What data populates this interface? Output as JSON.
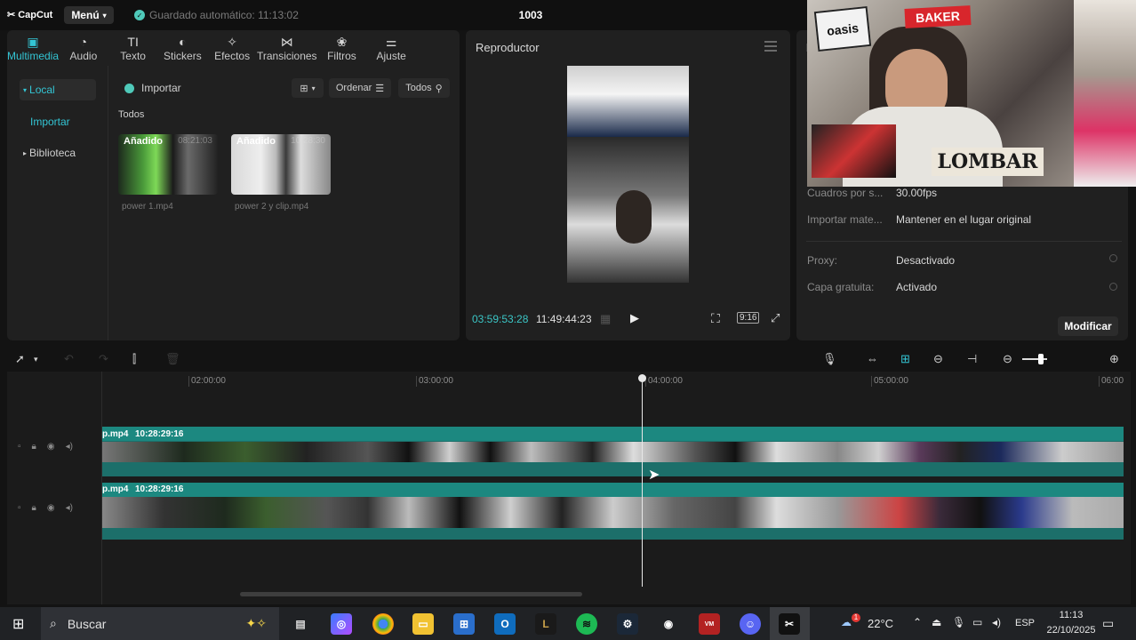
{
  "app": {
    "logo_text": "CapCut",
    "menu_label": "Menú",
    "autosave_text": "Guardado automático: 11:13:02",
    "project_title": "1003"
  },
  "media_tabs": [
    {
      "label": "Multimedia",
      "icon": "media-icon"
    },
    {
      "label": "Audio",
      "icon": "audio-icon"
    },
    {
      "label": "Texto",
      "icon": "text-icon"
    },
    {
      "label": "Stickers",
      "icon": "sticker-icon"
    },
    {
      "label": "Efectos",
      "icon": "effects-icon"
    },
    {
      "label": "Transiciones",
      "icon": "transitions-icon"
    },
    {
      "label": "Filtros",
      "icon": "filters-icon"
    },
    {
      "label": "Ajuste",
      "icon": "adjust-icon"
    }
  ],
  "sidebar": {
    "items": [
      {
        "label": "Local"
      },
      {
        "label": "Importar"
      },
      {
        "label": "Biblioteca"
      }
    ]
  },
  "media": {
    "import_label": "Importar",
    "sort_label": "Ordenar",
    "filter_label": "Todos",
    "section_label": "Todos",
    "files": [
      {
        "name": "power 1.mp4",
        "badge": "Añadido",
        "duration": "08:21:03"
      },
      {
        "name": "power 2 y clip.mp4",
        "badge": "Añadido",
        "duration": "10:28:30"
      }
    ]
  },
  "player": {
    "title": "Reproductor",
    "current_time": "03:59:53:28",
    "total_time": "11:49:44:23",
    "ratio_label": "9:16"
  },
  "details": {
    "header": "D",
    "rows": [
      {
        "label": "Cuadros por s...",
        "value": "30.00fps"
      },
      {
        "label": "Importar mate...",
        "value": "Mantener en el lugar original"
      },
      {
        "label": "Proxy:",
        "value": "Desactivado"
      },
      {
        "label": "Capa gratuita:",
        "value": "Activado"
      }
    ],
    "modify_label": "Modificar"
  },
  "timeline": {
    "ruler": [
      "02:00:00",
      "03:00:00",
      "04:00:00",
      "05:00:00",
      "06:00"
    ],
    "tracks": [
      {
        "clip_name": "p.mp4",
        "clip_duration": "10:28:29:16"
      },
      {
        "clip_name": "p.mp4",
        "clip_duration": "10:28:29:16"
      }
    ]
  },
  "webcam": {
    "stickers": [
      "oasis",
      "BAKER",
      "LOMBAR"
    ]
  },
  "taskbar": {
    "search_placeholder": "Buscar",
    "weather": "22°C",
    "lang": "ESP",
    "time": "11:13",
    "date": "22/10/2025",
    "weather_badge": "1"
  }
}
